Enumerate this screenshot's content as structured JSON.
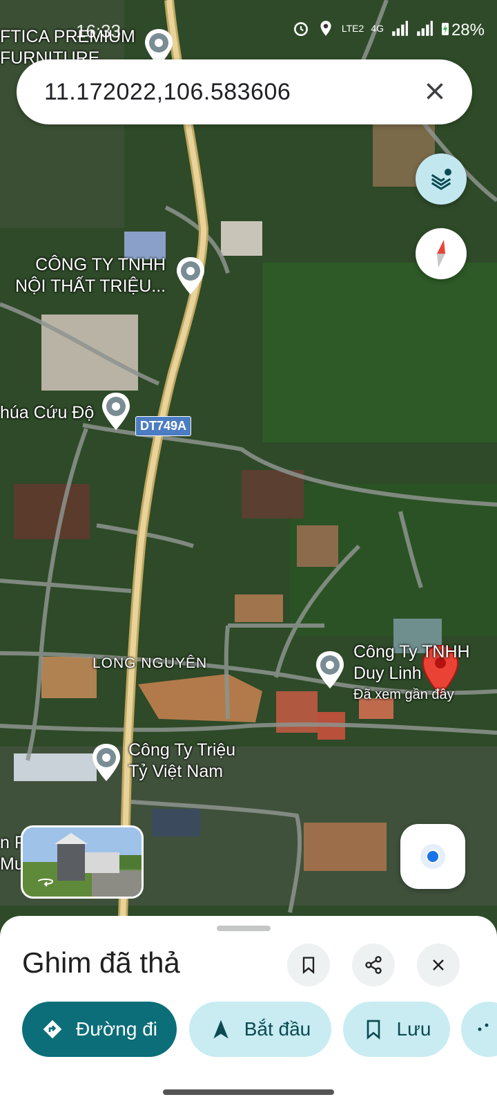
{
  "status_bar": {
    "time": "16:33",
    "network_label": "LTE2",
    "signal_label": "4G",
    "battery": "28%"
  },
  "search": {
    "query": "11.172022,106.583606"
  },
  "map": {
    "places": [
      {
        "id": "p1",
        "name": "FTICA PREMIUM\nFURNITURE"
      },
      {
        "id": "p2",
        "name": "CÔNG TY TNHH\nNỘI THẤT TRIỆU..."
      },
      {
        "id": "p3",
        "name": "húa Cứu Độ"
      },
      {
        "id": "p4",
        "name": "Công Ty TNHH\nDuy Linh"
      },
      {
        "id": "p5",
        "name": "Công Ty Triệu\nTỷ Việt Nam"
      },
      {
        "id": "p6",
        "name": "n P\nMu"
      }
    ],
    "area_label": "LONG NGUYÊN",
    "road_shield": "DT749A",
    "recently_viewed": "Đã xem gần đây"
  },
  "sheet": {
    "title": "Ghim đã thả",
    "buttons": {
      "directions": "Đường đi",
      "start": "Bắt đầu",
      "save": "Lưu"
    }
  },
  "colors": {
    "directions_bg": "#0b6e79",
    "pill_bg": "#c8ecf2",
    "pin_red": "#ea4335",
    "layers_bg": "#c2e7ef"
  }
}
